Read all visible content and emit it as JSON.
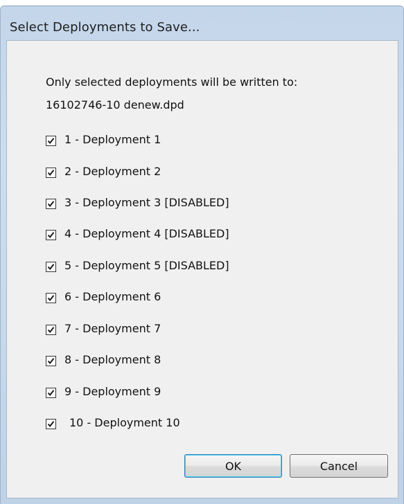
{
  "window": {
    "title": "Select Deployments to Save..."
  },
  "message": {
    "line1": "Only selected deployments will be written to:",
    "line2": "16102746-10 denew.dpd"
  },
  "deployments": [
    {
      "label": "1 - Deployment 1",
      "checked": true
    },
    {
      "label": "2 - Deployment 2",
      "checked": true
    },
    {
      "label": "3 - Deployment 3 [DISABLED]",
      "checked": true
    },
    {
      "label": "4 - Deployment 4 [DISABLED]",
      "checked": true
    },
    {
      "label": "5 - Deployment 5 [DISABLED]",
      "checked": true
    },
    {
      "label": "6 - Deployment 6",
      "checked": true
    },
    {
      "label": "7 - Deployment 7",
      "checked": true
    },
    {
      "label": "8 - Deployment 8",
      "checked": true
    },
    {
      "label": "9 - Deployment 9",
      "checked": true
    },
    {
      "label": "10 - Deployment 10",
      "checked": true
    }
  ],
  "buttons": {
    "ok_label": "OK",
    "cancel_label": "Cancel"
  },
  "colors": {
    "title_bar": "#c9daec",
    "dialog_bg": "#f0f0f0",
    "default_button_border": "#3c7fb1"
  }
}
